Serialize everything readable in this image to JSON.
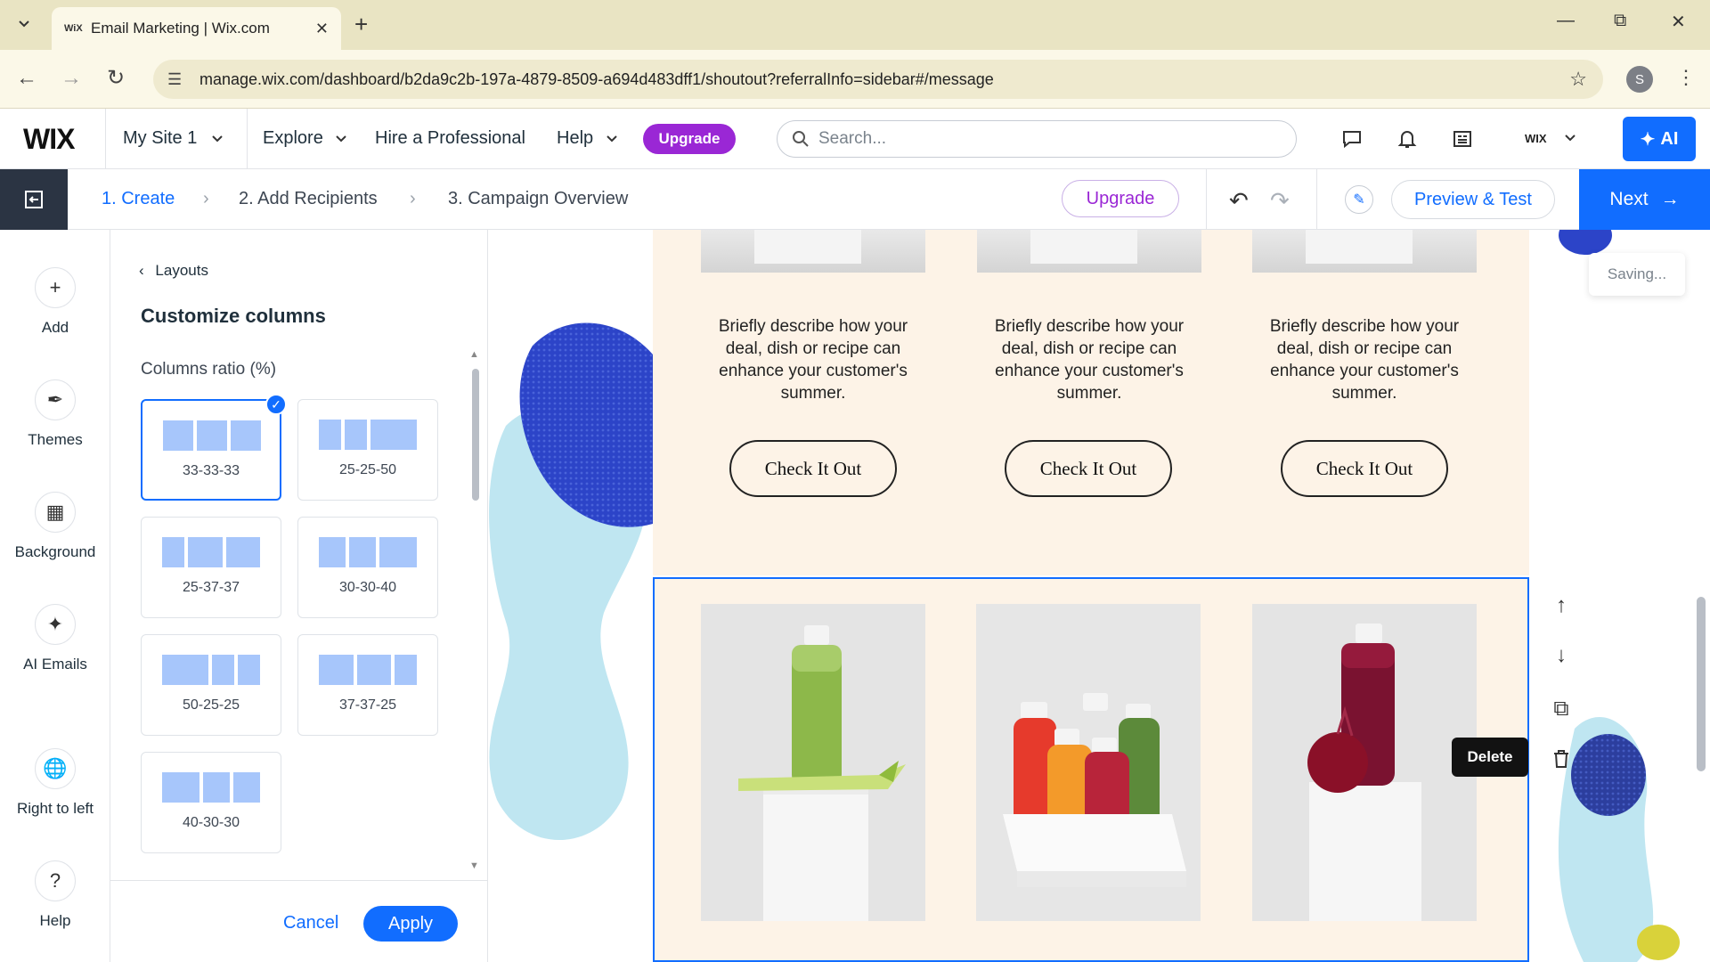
{
  "browser": {
    "tab_favicon": "WiX",
    "tab_title": "Email Marketing | Wix.com",
    "tab_close": "✕",
    "new_tab": "+",
    "url": "manage.wix.com/dashboard/b2da9c2b-197a-4879-8509-a694d483dff1/shoutout?referralInfo=sidebar#/message",
    "profile_initial": "S"
  },
  "topbar": {
    "logo": "WIX",
    "site_menu": "My Site 1",
    "explore": "Explore",
    "hire": "Hire a Professional",
    "help": "Help",
    "upgrade": "Upgrade",
    "search_placeholder": "Search...",
    "account": "WIX",
    "ai_button": "AI"
  },
  "campaign_bar": {
    "steps": [
      "1. Create",
      "2. Add Recipients",
      "3. Campaign Overview"
    ],
    "active_step": 0,
    "upgrade": "Upgrade",
    "preview": "Preview & Test",
    "next": "Next"
  },
  "rail": {
    "items": [
      {
        "label": "Add",
        "icon": "plus-icon"
      },
      {
        "label": "Themes",
        "icon": "brush-icon"
      },
      {
        "label": "Background",
        "icon": "background-icon"
      },
      {
        "label": "AI Emails",
        "icon": "sparkle-icon"
      },
      {
        "label": "Right to left",
        "icon": "globe-icon"
      },
      {
        "label": "Help",
        "icon": "question-icon"
      }
    ]
  },
  "panel": {
    "back_label": "Layouts",
    "title": "Customize columns",
    "ratio_label": "Columns ratio (%)",
    "options": [
      {
        "label": "33-33-33",
        "selected": true
      },
      {
        "label": "25-25-50",
        "selected": false
      },
      {
        "label": "25-37-37",
        "selected": false
      },
      {
        "label": "30-30-40",
        "selected": false
      },
      {
        "label": "50-25-25",
        "selected": false
      },
      {
        "label": "37-37-25",
        "selected": false
      },
      {
        "label": "40-30-30",
        "selected": false
      }
    ],
    "cancel": "Cancel",
    "apply": "Apply"
  },
  "email": {
    "description": "Briefly describe how your deal, dish or recipe can enhance your customer's summer.",
    "cta": "Check It Out",
    "products": [
      "green-juice-bottle",
      "juice-bottles-pack",
      "beet-juice-bottle"
    ]
  },
  "canvas": {
    "saving": "Saving...",
    "tooltip": "Delete"
  },
  "colors": {
    "accent": "#116dff",
    "upgrade": "#9a27d5",
    "email_bg": "#fdf3e7",
    "blob": "#2c44c8"
  }
}
